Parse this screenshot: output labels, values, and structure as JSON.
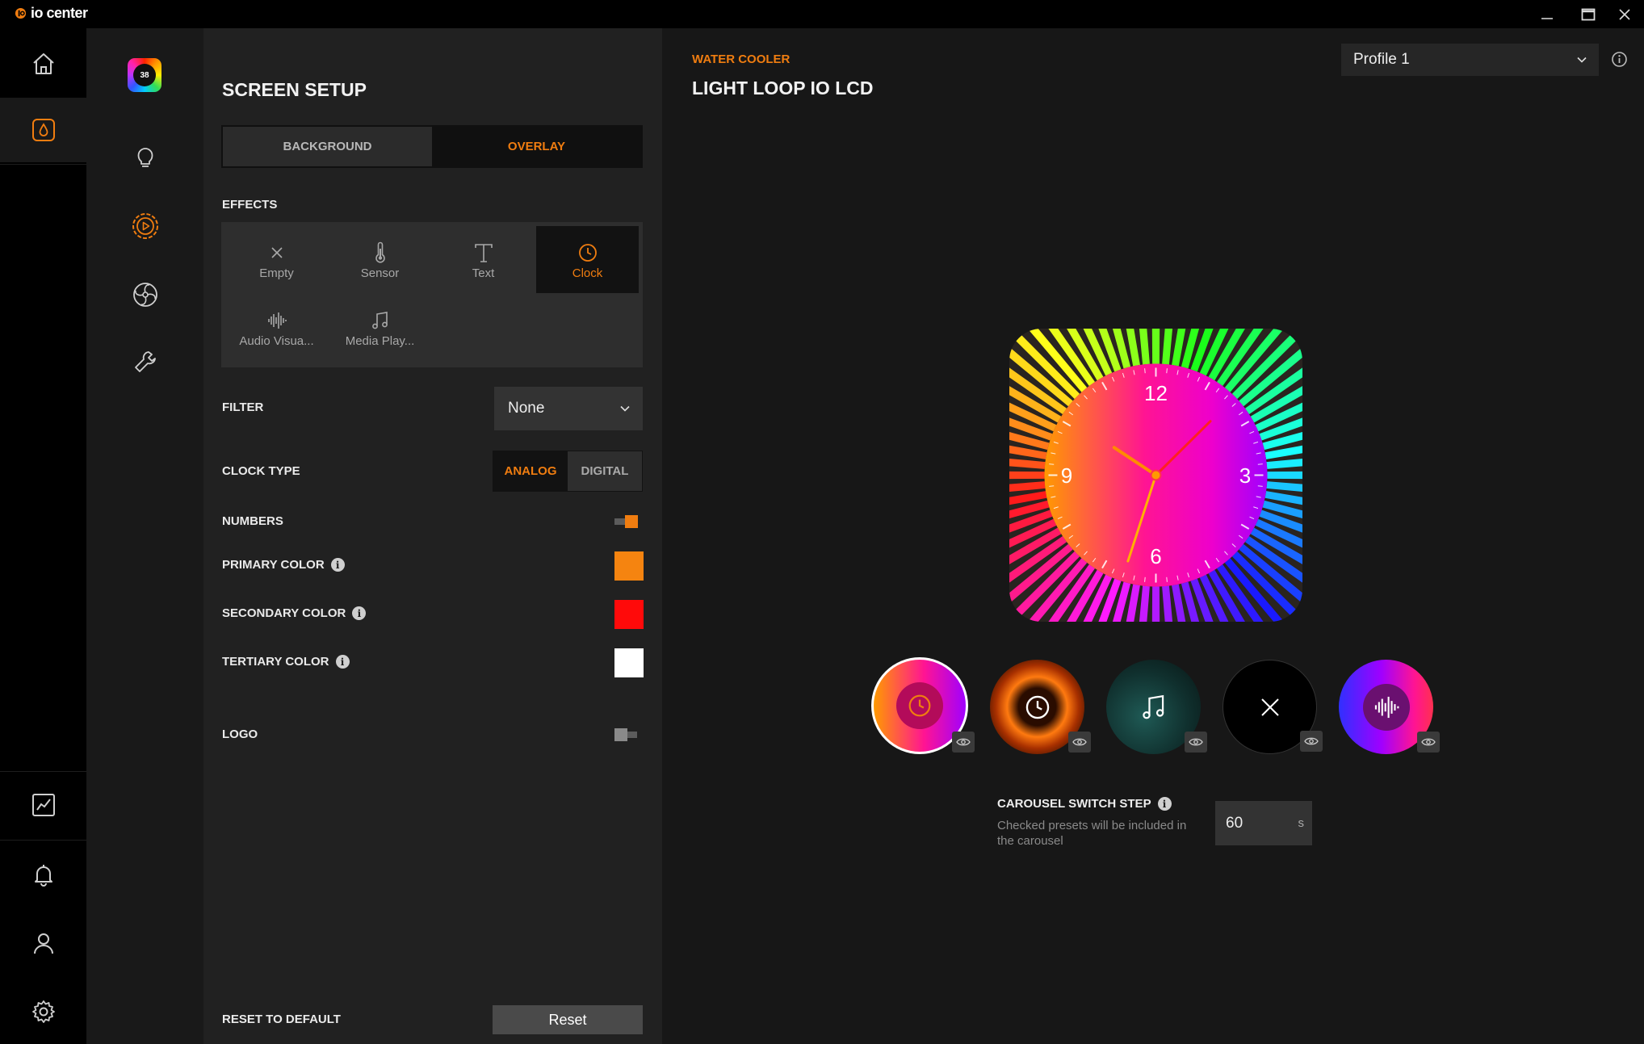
{
  "app": {
    "brand": "io center"
  },
  "device_badge": "38",
  "panel": {
    "title": "SCREEN SETUP",
    "tabs": [
      {
        "label": "BACKGROUND"
      },
      {
        "label": "OVERLAY"
      }
    ],
    "effects_label": "EFFECTS",
    "effects": [
      {
        "label": "Empty",
        "icon": "x-icon"
      },
      {
        "label": "Sensor",
        "icon": "thermometer-icon"
      },
      {
        "label": "Text",
        "icon": "text-icon"
      },
      {
        "label": "Clock",
        "icon": "clock-icon",
        "selected": true
      },
      {
        "label": "Audio Visua...",
        "icon": "waveform-icon"
      },
      {
        "label": "Media Play...",
        "icon": "music-note-icon"
      }
    ],
    "filter_label": "FILTER",
    "filter_value": "None",
    "clock_type_label": "CLOCK TYPE",
    "clock_types": [
      {
        "label": "ANALOG",
        "active": true
      },
      {
        "label": "DIGITAL",
        "active": false
      }
    ],
    "numbers_label": "NUMBERS",
    "numbers_on": true,
    "primary_color_label": "PRIMARY COLOR",
    "primary_color": "#F58410",
    "secondary_color_label": "SECONDARY COLOR",
    "secondary_color": "#FF0A0A",
    "tertiary_color_label": "TERTIARY COLOR",
    "tertiary_color": "#FFFFFF",
    "logo_label": "LOGO",
    "logo_on": false,
    "reset_label": "RESET TO DEFAULT",
    "reset_button": "Reset"
  },
  "main": {
    "eyebrow": "WATER COOLER",
    "device_title": "LIGHT LOOP IO LCD",
    "profile": "Profile 1",
    "clock": {
      "numbers": [
        "12",
        "3",
        "6",
        "9"
      ],
      "hour": 10,
      "minute": 7,
      "second": 33
    },
    "presets": [
      {
        "name": "clock-overlay",
        "icon": "clock-icon",
        "selected": true
      },
      {
        "name": "clock-vortex",
        "icon": "clock-icon",
        "selected": false
      },
      {
        "name": "media-player",
        "icon": "music-note-icon",
        "selected": false
      },
      {
        "name": "empty",
        "icon": "x-icon",
        "selected": false
      },
      {
        "name": "audio-visualizer",
        "icon": "waveform-icon",
        "selected": false
      }
    ],
    "carousel_label": "CAROUSEL SWITCH STEP",
    "carousel_help": "Checked presets will be included in the carousel",
    "carousel_value": "60",
    "carousel_unit": "s"
  },
  "colors": {
    "accent": "#F07D10"
  }
}
